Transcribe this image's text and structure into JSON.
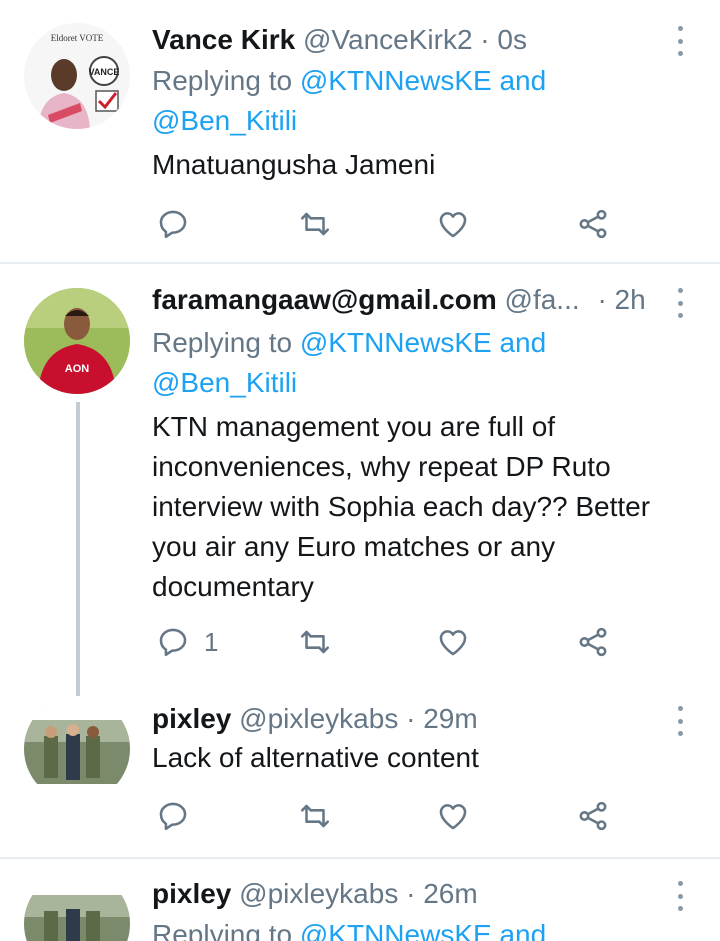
{
  "tweets": [
    {
      "name": "Vance Kirk",
      "handle": "@VanceKirk2",
      "sep": "·",
      "time": "0s",
      "replying_prefix": "Replying to",
      "mention1": "@KTNNewsKE",
      "and": "and",
      "mention2": "@Ben_Kitili",
      "text": "Mnatuangusha Jameni",
      "reply_count": "",
      "avatar_text": "VANCE",
      "avatar_caption": "Eldoret VOTE"
    },
    {
      "name": "faramangaaw@gmail.com",
      "handle": "@fa...",
      "sep": "·",
      "time": "2h",
      "replying_prefix": "Replying to",
      "mention1": "@KTNNewsKE",
      "and": "and",
      "mention2": "@Ben_Kitili",
      "text_lines": [
        "KTN management you are full of",
        "inconveniences, why repeat DP Ruto",
        "interview with Sophia each day?? Better",
        "you air any Euro matches or any",
        "documentary"
      ],
      "reply_count": "1",
      "avatar_shirt_text": "AON"
    },
    {
      "name": "pixley",
      "handle": "@pixleykabs",
      "sep": "·",
      "time": "29m",
      "text": "Lack of alternative content",
      "reply_count": ""
    },
    {
      "name": "pixley",
      "handle": "@pixleykabs",
      "sep": "·",
      "time": "26m",
      "replying_prefix": "Replying to",
      "mention1": "@KTNNewsKE",
      "and": "and"
    }
  ],
  "icons": [
    "reply-icon",
    "retweet-icon",
    "like-icon",
    "share-icon",
    "more-options-icon"
  ]
}
